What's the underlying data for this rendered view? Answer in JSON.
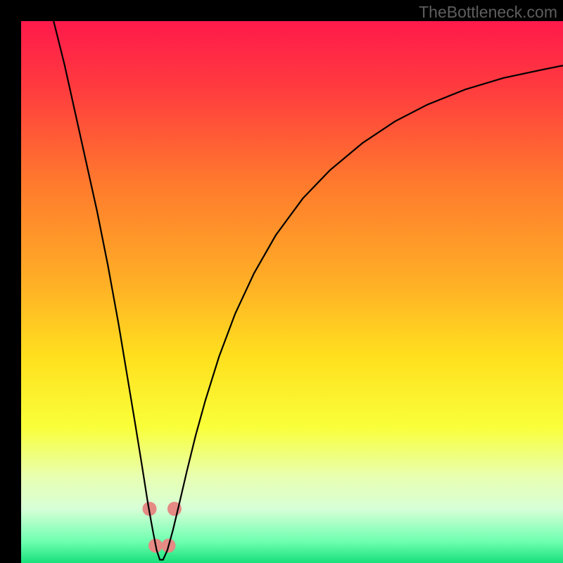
{
  "watermark": "TheBottleneck.com",
  "chart_data": {
    "type": "line",
    "title": "",
    "xlabel": "",
    "ylabel": "",
    "xlim": [
      0,
      100
    ],
    "ylim": [
      0,
      100
    ],
    "grid": false,
    "background_gradient": {
      "stops": [
        {
          "offset": 0.0,
          "color": "#ff1a4b"
        },
        {
          "offset": 0.12,
          "color": "#ff3a3f"
        },
        {
          "offset": 0.3,
          "color": "#ff7a2d"
        },
        {
          "offset": 0.48,
          "color": "#ffae26"
        },
        {
          "offset": 0.62,
          "color": "#ffe01e"
        },
        {
          "offset": 0.75,
          "color": "#f9ff3a"
        },
        {
          "offset": 0.84,
          "color": "#e8ffb0"
        },
        {
          "offset": 0.9,
          "color": "#d7ffd7"
        },
        {
          "offset": 0.96,
          "color": "#6fffb0"
        },
        {
          "offset": 1.0,
          "color": "#18e07a"
        }
      ]
    },
    "series": [
      {
        "name": "bottleneck-curve",
        "stroke": "#000000",
        "stroke_width": 2.2,
        "x": [
          6.0,
          8.0,
          10.0,
          12.0,
          14.0,
          16.0,
          18.0,
          19.5,
          21.0,
          22.3,
          23.4,
          24.3,
          25.0,
          25.6,
          26.2,
          27.0,
          28.0,
          29.2,
          30.6,
          32.2,
          34.0,
          36.5,
          39.5,
          43.0,
          47.0,
          52.0,
          57.0,
          63.0,
          69.0,
          75.0,
          82.0,
          89.0,
          96.0,
          100.0
        ],
        "y": [
          100.0,
          92.0,
          83.0,
          74.0,
          65.0,
          55.0,
          44.0,
          35.0,
          26.0,
          18.0,
          11.0,
          6.0,
          2.4,
          0.6,
          0.6,
          2.4,
          6.0,
          11.0,
          17.0,
          23.5,
          30.0,
          38.0,
          46.0,
          53.5,
          60.5,
          67.3,
          72.5,
          77.5,
          81.5,
          84.6,
          87.4,
          89.5,
          91.0,
          91.8
        ]
      }
    ],
    "markers": [
      {
        "name": "marker-left-upper",
        "x": 23.7,
        "y": 10.0,
        "color": "#e58a84",
        "r": 10
      },
      {
        "name": "marker-right-upper",
        "x": 28.3,
        "y": 10.0,
        "color": "#e58a84",
        "r": 10
      },
      {
        "name": "marker-left-lower",
        "x": 24.8,
        "y": 3.2,
        "color": "#e58a84",
        "r": 10
      },
      {
        "name": "marker-right-lower",
        "x": 27.2,
        "y": 3.2,
        "color": "#e58a84",
        "r": 10
      }
    ]
  }
}
